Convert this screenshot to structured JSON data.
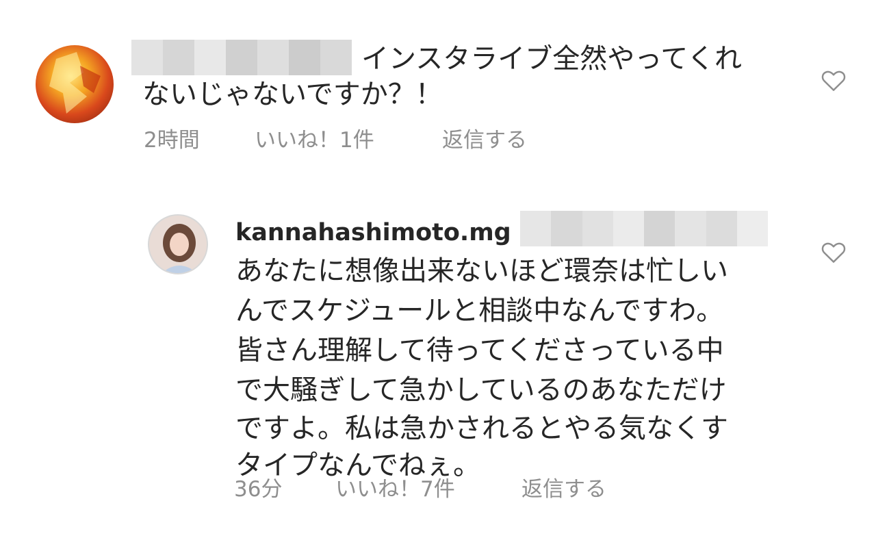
{
  "comments": [
    {
      "username": "",
      "text_lines": [
        "インスタライブ全然やってくれ",
        "ないじゃないですか？！"
      ],
      "time": "2時間",
      "likes_label": "いいね！1件",
      "reply_label": "返信する",
      "heart_icon": "heart-outline-icon"
    },
    {
      "username": "kannahashimoto.mg",
      "text_lines": [
        "あなたに想像出来ないほど環奈は忙しい",
        "んでスケジュールと相談中なんですわ。",
        "皆さん理解して待ってくださっている中",
        "で大騒ぎして急かしているのあなただけ",
        "ですよ。私は急かされるとやる気なくす",
        "タイプなんでねぇ。"
      ],
      "time": "36分",
      "likes_label": "いいね！7件",
      "reply_label": "返信する",
      "heart_icon": "heart-outline-icon"
    }
  ],
  "colors": {
    "text": "#262626",
    "meta": "#8e8e8e",
    "heart": "#8e8e8e"
  }
}
